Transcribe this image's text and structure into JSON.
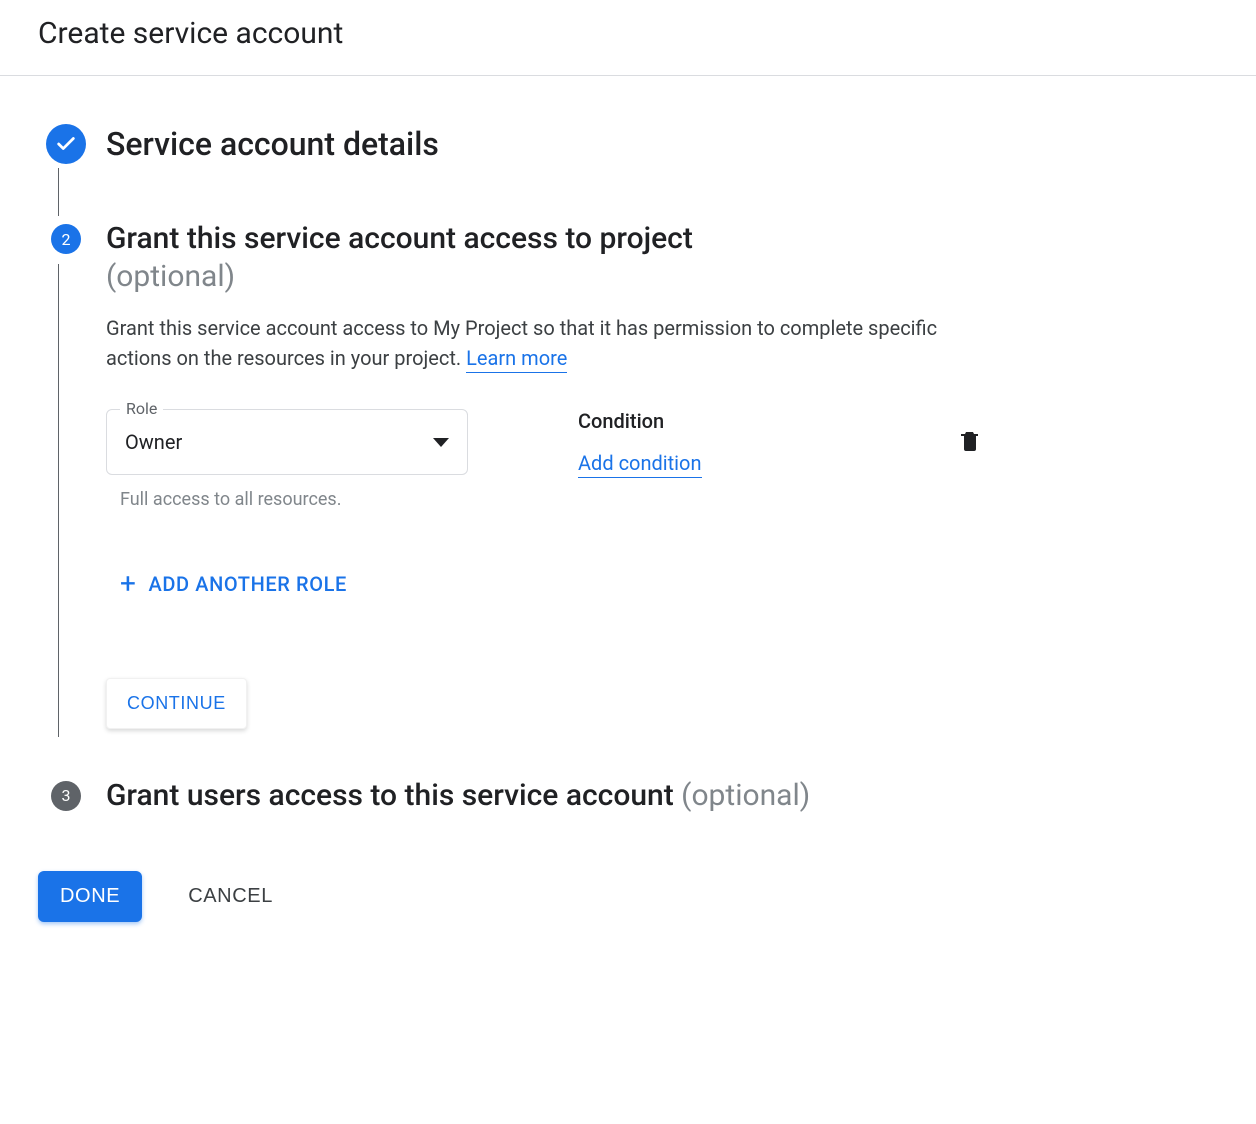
{
  "header": {
    "title": "Create service account"
  },
  "steps": {
    "s1": {
      "title": "Service account details"
    },
    "s2": {
      "number": "2",
      "title": "Grant this service account access to project",
      "optional": "(optional)",
      "description_pre": "Grant this service account access to My Project so that it has permission to complete specific actions on the resources in your project. ",
      "learn_more": "Learn more",
      "role_label": "Role",
      "role_value": "Owner",
      "role_helper": "Full access to all resources.",
      "condition_label": "Condition",
      "add_condition": "Add condition",
      "add_another_role": "ADD ANOTHER ROLE",
      "continue": "CONTINUE"
    },
    "s3": {
      "number": "3",
      "title": "Grant users access to this service account ",
      "optional": "(optional)"
    }
  },
  "actions": {
    "done": "DONE",
    "cancel": "CANCEL"
  }
}
